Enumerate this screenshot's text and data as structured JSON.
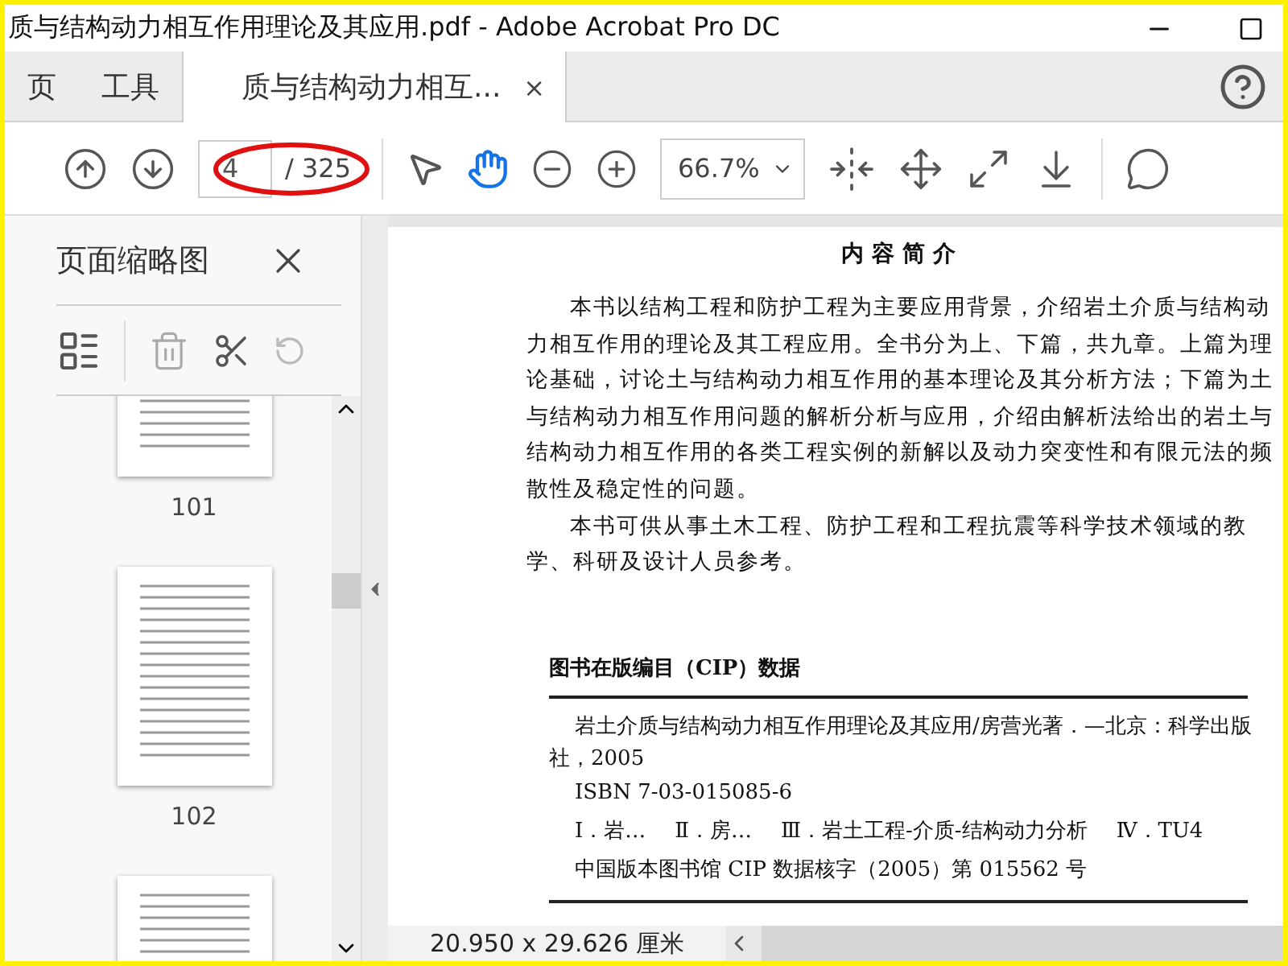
{
  "window": {
    "title": "质与结构动力相互作用理论及其应用.pdf - Adobe Acrobat Pro DC"
  },
  "tabs": [
    {
      "label": "页",
      "selected": false
    },
    {
      "label": "工具",
      "selected": false
    },
    {
      "label": "质与结构动力相互...",
      "selected": true,
      "close": "×"
    }
  ],
  "toolbar": {
    "page": "4",
    "page_total": "/ 325",
    "zoom": "66.7%",
    "annotation": true,
    "tools": [
      {
        "kind": "select",
        "selected": false
      },
      {
        "kind": "hand",
        "selected": true
      }
    ]
  },
  "sidebar": {
    "title": "页面缩略图",
    "thumbnails": [
      {
        "label": "101"
      },
      {
        "label": "102"
      }
    ]
  },
  "document": {
    "heading": "内 容 简 介",
    "paragraphs": [
      "本书以结构工程和防护工程为主要应用背景，介绍岩土介质与结构动力相互作用的理论及其工程应用。全书分为上、下篇，共九章。上篇为理论基础，讨论土与结构动力相互作用的基本理论及其分析方法；下篇为土与结构动力相互作用问题的解析分析与应用，介绍由解析法给出的岩土与结构动力相互作用的各类工程实例的新解以及动力突变性和有限元法的频散性及稳定性的问题。",
      "本书可供从事土木工程、防护工程和工程抗震等科学技术领域的教学、科研及设计人员参考。"
    ],
    "cip": {
      "heading": "图书在版编目（CIP）数据",
      "citation": "岩土介质与结构动力相互作用理论及其应用/房营光著．—北京：科学出版社，2005",
      "isbn": "ISBN 7-03-015085-6",
      "classes": [
        "Ⅰ．岩…",
        "Ⅱ．房…",
        "Ⅲ．岩土工程-介质-结构动力分析",
        "Ⅳ．TU4"
      ],
      "record": "中国版本图书馆 CIP 数据核字（2005）第 015562 号"
    }
  },
  "status_bar": {
    "size": "20.950 x 29.626 厘米"
  }
}
